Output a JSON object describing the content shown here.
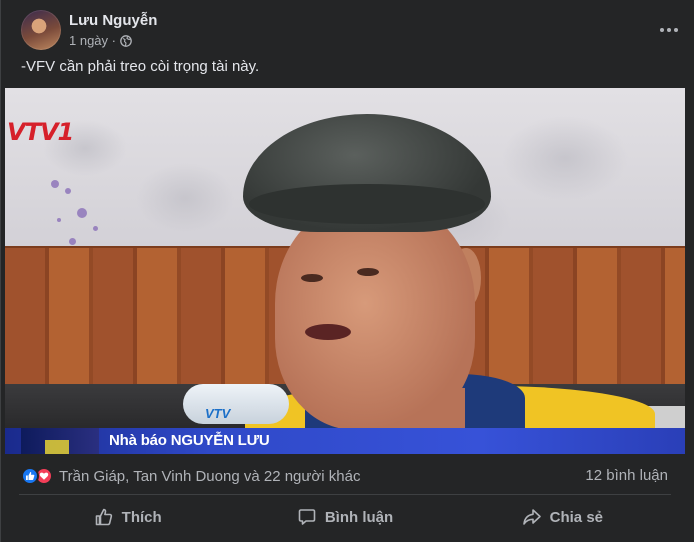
{
  "post": {
    "author": "Lưu Nguyễn",
    "time": "1 ngày ·",
    "caption": "-VFV cần phải treo còi trọng tài này."
  },
  "media": {
    "channel_logo": "VTV1",
    "mic_logo": "VTV",
    "lower_third": "Nhà báo NGUYỄN LƯU"
  },
  "stats": {
    "reaction_names": "Trần Giáp, Tan Vinh Duong và 22 người khác",
    "comments": "12 bình luận",
    "reaction_icons": [
      "like-icon",
      "love-icon"
    ]
  },
  "actions": {
    "like": "Thích",
    "comment": "Bình luận",
    "share": "Chia sẻ"
  },
  "colors": {
    "background": "#242526",
    "text": "#e4e6eb",
    "muted": "#b0b3b8",
    "like_blue": "#1877f2",
    "love_red": "#f33e58"
  }
}
